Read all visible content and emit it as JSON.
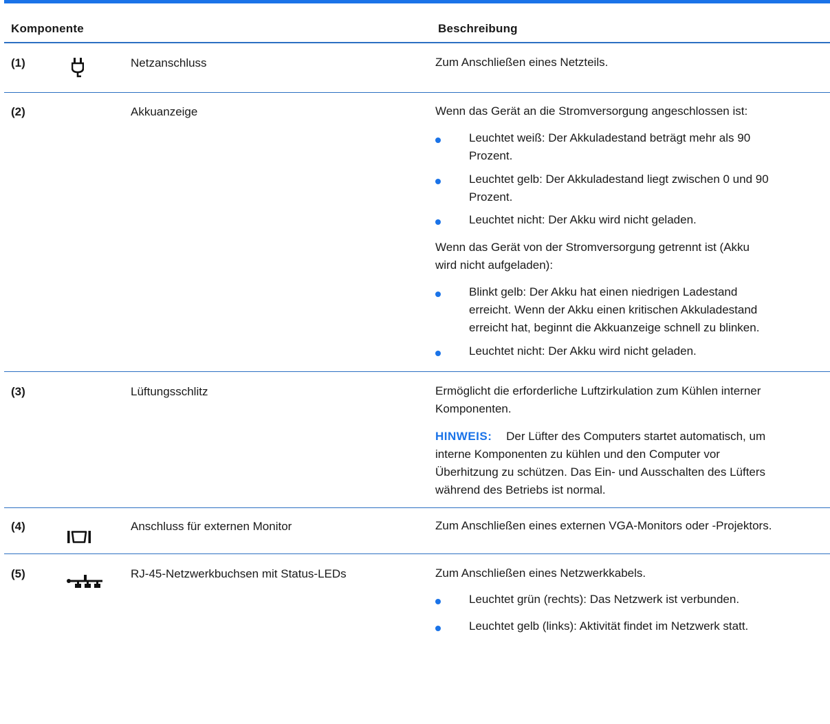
{
  "header": {
    "col_component": "Komponente",
    "col_description": "Beschreibung"
  },
  "rows": [
    {
      "number": "(1)",
      "icon": "power-plug-icon",
      "name": "Netzanschluss",
      "description": "Zum Anschließen eines Netzteils."
    },
    {
      "number": "(2)",
      "icon": "",
      "name": "Akkuanzeige",
      "intro": "Wenn das Gerät an die Stromversorgung angeschlossen ist:",
      "bullets_connected": [
        [
          "Leuchtet weiß: Der Akkuladestand beträgt mehr als 90",
          "Prozent."
        ],
        [
          "Leuchtet gelb: Der Akkuladestand liegt zwischen 0 und 90",
          "Prozent."
        ],
        [
          "Leuchtet nicht: Der Akku wird nicht geladen."
        ]
      ],
      "intro2": [
        "Wenn das Gerät von der Stromversorgung getrennt ist (Akku",
        "wird nicht aufgeladen):"
      ],
      "bullets_disconnected": [
        [
          "Blinkt gelb: Der Akku hat einen niedrigen Ladestand",
          "erreicht. Wenn der Akku einen kritischen Akkuladestand",
          "erreicht hat, beginnt die Akkuanzeige schnell zu blinken."
        ],
        [
          "Leuchtet nicht: Der Akku wird nicht geladen."
        ]
      ]
    },
    {
      "number": "(3)",
      "icon": "",
      "name": "Lüftungsschlitz",
      "description": [
        "Ermöglicht die erforderliche Luftzirkulation zum Kühlen interner",
        "Komponenten."
      ],
      "note_label": "HINWEIS:",
      "note": [
        "Der Lüfter des Computers startet automatisch, um",
        "interne Komponenten zu kühlen und den Computer vor",
        "Überhitzung zu schützen. Das Ein- und Ausschalten des Lüfters",
        "während des Betriebs ist normal."
      ]
    },
    {
      "number": "(4)",
      "icon": "external-monitor-port-icon",
      "name": "Anschluss für externen Monitor",
      "description": "Zum Anschließen eines externen VGA-Monitors oder -Projektors."
    },
    {
      "number": "(5)",
      "icon": "network-jack-icon",
      "name": "RJ-45-Netzwerkbuchsen mit Status-LEDs",
      "description": "Zum Anschließen eines Netzwerkkabels.",
      "bullets": [
        "Leuchtet grün (rechts): Das Netzwerk ist verbunden.",
        "Leuchtet gelb (links): Aktivität findet im Netzwerk statt."
      ]
    }
  ],
  "colors": {
    "accent": "#1a73e8",
    "rule": "#2b6fc2",
    "text": "#1a1a1a"
  }
}
